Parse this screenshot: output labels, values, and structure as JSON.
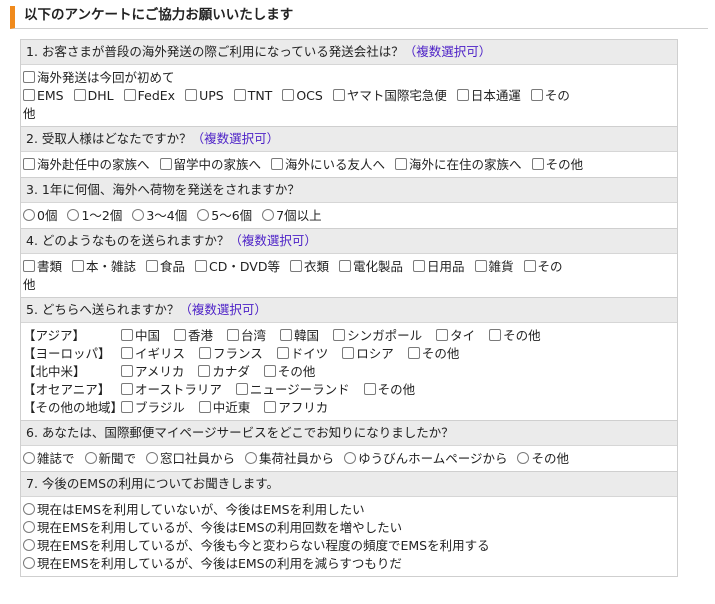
{
  "heading": "以下のアンケートにご協力お願いいたします",
  "multi_tag": "（複数選択可）",
  "q1": {
    "title": "1.  お客さまが普段の海外発送の際ご利用になっている発送会社は？",
    "first": "海外発送は今回が初めて",
    "options": [
      "EMS",
      "DHL",
      "FedEx",
      "UPS",
      "TNT",
      "OCS",
      "ヤマト国際宅急便",
      "日本通運"
    ],
    "other_a": "その",
    "other_b": "他"
  },
  "q2": {
    "title": "2.  受取人様はどなたですか？",
    "options": [
      "海外赴任中の家族へ",
      "留学中の家族へ",
      "海外にいる友人へ",
      "海外に在住の家族へ",
      "その他"
    ]
  },
  "q3": {
    "title": "3.  1年に何個、海外へ荷物を発送をされますか？",
    "options": [
      "0個",
      "1〜2個",
      "3〜4個",
      "5〜6個",
      "7個以上"
    ]
  },
  "q4": {
    "title": "4.  どのようなものを送られますか？",
    "options": [
      "書類",
      "本・雑誌",
      "食品",
      "CD・DVD等",
      "衣類",
      "電化製品",
      "日用品",
      "雑貨"
    ],
    "other_a": "その",
    "other_b": "他"
  },
  "q5": {
    "title": "5.  どちらへ送られますか？",
    "regions": [
      {
        "label": "【アジア】",
        "options": [
          "中国",
          "香港",
          "台湾",
          "韓国",
          "シンガポール",
          "タイ",
          "その他"
        ]
      },
      {
        "label": "【ヨーロッパ】",
        "options": [
          "イギリス",
          "フランス",
          "ドイツ",
          "ロシア",
          "その他"
        ]
      },
      {
        "label": "【北中米】",
        "options": [
          "アメリカ",
          "カナダ",
          "その他"
        ]
      },
      {
        "label": "【オセアニア】",
        "options": [
          "オーストラリア",
          "ニュージーランド",
          "その他"
        ]
      },
      {
        "label": "【その他の地域】",
        "options": [
          "ブラジル",
          "中近東",
          "アフリカ"
        ]
      }
    ]
  },
  "q6": {
    "title": "6.  あなたは、国際郵便マイページサービスをどこでお知りになりましたか？",
    "options": [
      "雑誌で",
      "新聞で",
      "窓口社員から",
      "集荷社員から",
      "ゆうびんホームページから",
      "その他"
    ]
  },
  "q7": {
    "title": "7.  今後のEMSの利用についてお聞きします。",
    "options": [
      "現在はEMSを利用していないが、今後はEMSを利用したい",
      "現在EMSを利用しているが、今後はEMSの利用回数を増やしたい",
      "現在EMSを利用しているが、今後も今と変わらない程度の頻度でEMSを利用する",
      "現在EMSを利用しているが、今後はEMSの利用を減らすつもりだ"
    ]
  }
}
